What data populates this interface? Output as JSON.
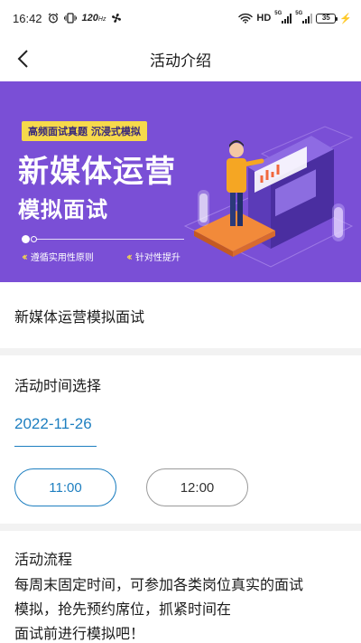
{
  "status_bar": {
    "time": "16:42",
    "speed_value": "120",
    "speed_unit": "Hz",
    "hd": "HD",
    "sim1": "5G",
    "sim2": "5G",
    "battery": "35"
  },
  "nav": {
    "title": "活动介绍"
  },
  "banner": {
    "tag": "高频面试真题 沉浸式模拟",
    "title_line1": "新媒体运营",
    "title_line2": "模拟面试",
    "feature1": "遵循实用性原则",
    "feature2": "针对性提升",
    "colors": {
      "background": "#7a4fd6",
      "accent": "#f6d94b"
    }
  },
  "activity": {
    "name": "新媒体运营模拟面试"
  },
  "time_select": {
    "title": "活动时间选择",
    "date": "2022-11-26",
    "slots": [
      {
        "label": "11:00",
        "selected": true
      },
      {
        "label": "12:00",
        "selected": false
      }
    ],
    "accent_color": "#1e7fc0"
  },
  "flow": {
    "title": "活动流程",
    "line1": "每周末固定时间，可参加各类岗位真实的面试",
    "line2": "模拟，抢先预约席位，抓紧时间在",
    "line3": "面试前进行模拟吧！"
  }
}
